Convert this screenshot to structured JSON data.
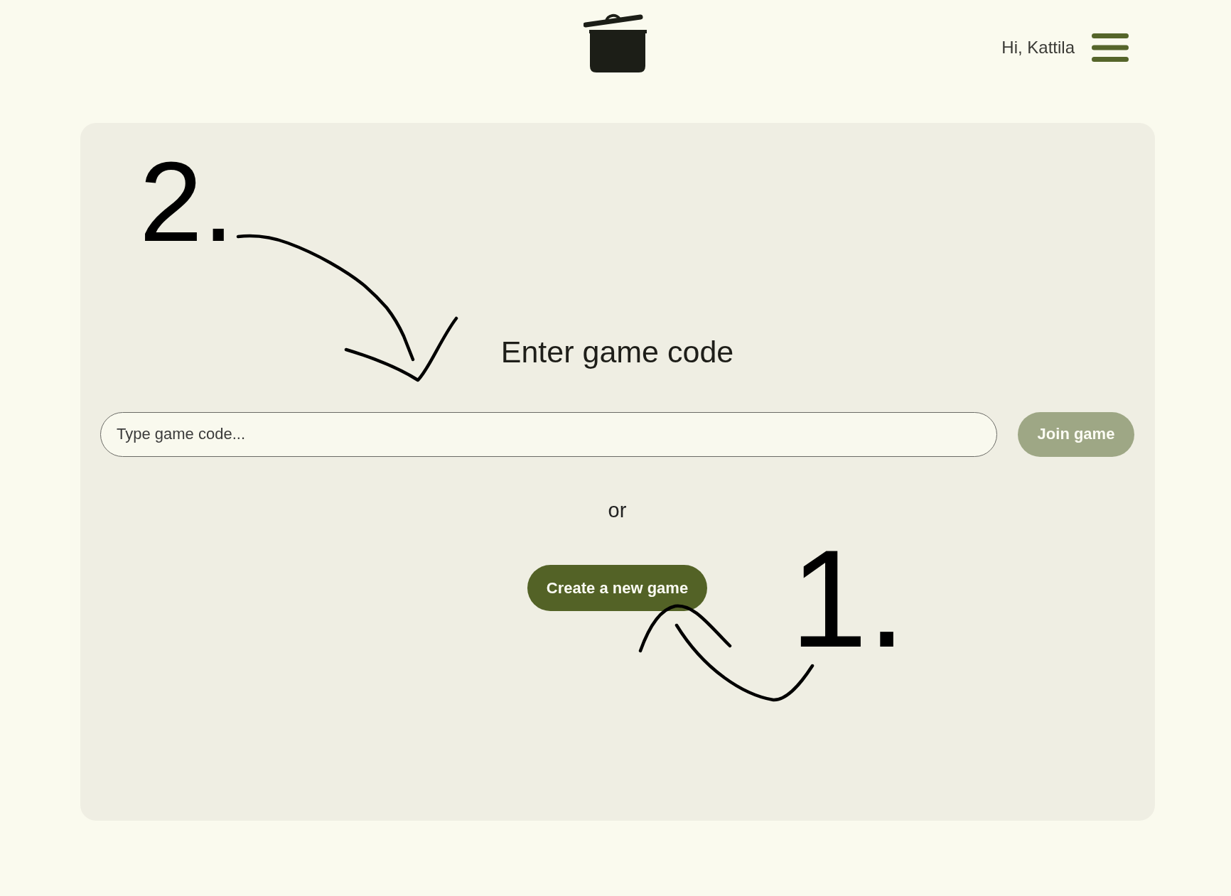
{
  "header": {
    "greeting": "Hi, Kattila"
  },
  "join": {
    "title": "Enter game code",
    "input": {
      "placeholder": "Type game code..."
    },
    "button": {
      "label": "Join game",
      "disabled": true
    }
  },
  "separator": "or",
  "create_button": {
    "label": "Create a new game",
    "disabled": false
  },
  "annotations": [
    {
      "label": "2."
    },
    {
      "label": "1."
    }
  ]
}
